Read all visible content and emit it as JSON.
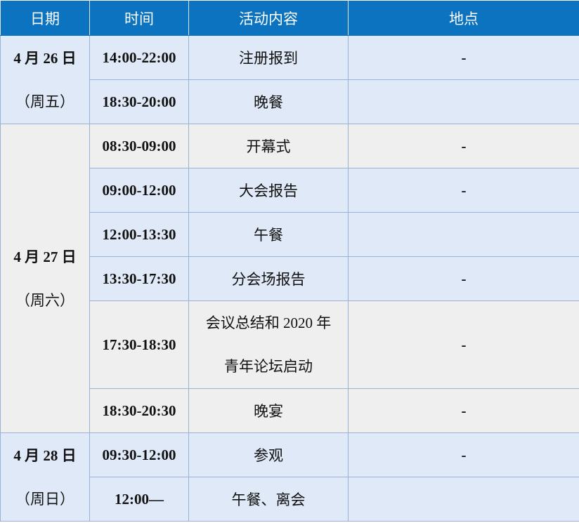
{
  "headers": {
    "date": "日期",
    "time": "时间",
    "activity": "活动内容",
    "location": "地点"
  },
  "days": [
    {
      "date_line1": "4 月 26 日",
      "date_line2": "（周五）",
      "events": [
        {
          "time": "14:00-22:00",
          "activity": "注册报到",
          "location": "-"
        },
        {
          "time": "18:30-20:00",
          "activity": "晚餐",
          "location": ""
        }
      ]
    },
    {
      "date_line1": "4 月 27 日",
      "date_line2": "（周六）",
      "events": [
        {
          "time": "08:30-09:00",
          "activity": "开幕式",
          "location": "-"
        },
        {
          "time": "09:00-12:00",
          "activity": "大会报告",
          "location": "-"
        },
        {
          "time": "12:00-13:30",
          "activity": "午餐",
          "location": ""
        },
        {
          "time": "13:30-17:30",
          "activity": "分会场报告",
          "location": "-"
        },
        {
          "time": "17:30-18:30",
          "activity_line1": "会议总结和 2020 年",
          "activity_line2": "青年论坛启动",
          "location": "-"
        },
        {
          "time": "18:30-20:30",
          "activity": "晚宴",
          "location": "-"
        }
      ]
    },
    {
      "date_line1": "4 月 28 日",
      "date_line2": "（周日）",
      "events": [
        {
          "time": "09:30-12:00",
          "activity": "参观",
          "location": "-"
        },
        {
          "time": "12:00—",
          "activity": "午餐、离会",
          "location": ""
        }
      ]
    }
  ],
  "colors": {
    "header_bg": "#0c73c1",
    "row_blue": "#dfe9f7",
    "row_grey": "#efefef",
    "border": "#9bb3d3"
  }
}
